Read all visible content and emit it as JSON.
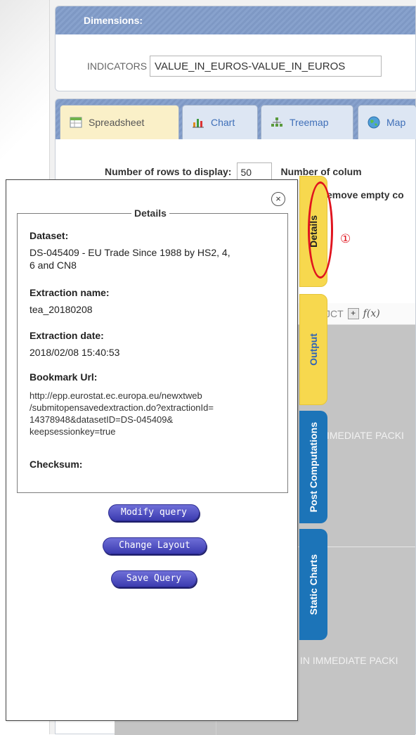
{
  "dimensions": {
    "header": "Dimensions:",
    "indicator_label": "INDICATORS",
    "indicator_value": "VALUE_IN_EUROS-VALUE_IN_EUROS"
  },
  "tabs": [
    {
      "label": "Spreadsheet",
      "icon": "spreadsheet-icon",
      "active": true
    },
    {
      "label": "Chart",
      "icon": "chart-icon",
      "active": false
    },
    {
      "label": "Treemap",
      "icon": "treemap-icon",
      "active": false
    },
    {
      "label": "Map",
      "icon": "globe-icon",
      "active": false
    }
  ],
  "options": {
    "rows_label": "Number of rows to display:",
    "rows_value": "50",
    "columns_label": "Number of colum",
    "remove_empty_label": "emove empty co"
  },
  "grid": {
    "header_text": "JCT",
    "fx_label": "f(x)",
    "cell_label_1": "IMEDIATE PACKI",
    "cell_label_2": "IN IMMEDIATE PACKI"
  },
  "side_tabs": {
    "details": "Details",
    "output": "Output",
    "post_computations": "Post Computations",
    "static_charts": "Static Charts"
  },
  "annotation": {
    "marker": "①",
    "color": "#e0141e"
  },
  "details_popup": {
    "legend": "Details",
    "close_symbol": "×",
    "dataset_label": "Dataset:",
    "dataset_line1": "DS-045409 - EU Trade Since 1988 by HS2, 4,",
    "dataset_line2": "6 and CN8",
    "extraction_name_label": "Extraction name:",
    "extraction_name": "tea_20180208",
    "extraction_date_label": "Extraction date:",
    "extraction_date": "2018/02/08 15:40:53",
    "bookmark_label": "Bookmark Url:",
    "bookmark_lines": [
      "http://epp.eurostat.ec.europa.eu/newxtweb",
      "/submitopensavedextraction.do?extractionId=",
      "14378948&datasetID=DS-045409&",
      "keepsessionkey=true"
    ],
    "checksum_label": "Checksum:",
    "buttons": {
      "modify": "Modify query",
      "change_layout": "Change Layout",
      "save": "Save Query"
    }
  },
  "colors": {
    "header_blue": "#7e98c4",
    "tab_yellow": "#f7d84e",
    "tab_blue": "#1c74b8",
    "button_blue": "#3b3bb0"
  }
}
